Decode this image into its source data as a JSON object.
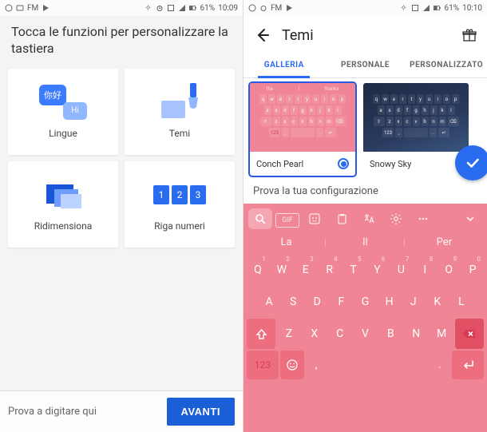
{
  "status1": {
    "fm": "FM",
    "pct": "61%",
    "time": "10:09"
  },
  "status2": {
    "fm": "FM",
    "pct": "61%",
    "time": "10:10"
  },
  "left": {
    "header": "Tocca le funzioni per personalizzare la tastiera",
    "tiles": {
      "lingue": {
        "label": "Lingue",
        "b1": "你好",
        "b2": "Hi"
      },
      "temi": {
        "label": "Temi"
      },
      "ridim": {
        "label": "Ridimensiona"
      },
      "riga": {
        "label": "Riga numeri",
        "n1": "1",
        "n2": "2",
        "n3": "3"
      }
    },
    "hint": "Prova a digitare qui",
    "avanti": "AVANTI"
  },
  "right": {
    "title": "Temi",
    "tabs": {
      "t1": "GALLERIA",
      "t2": "PERSONALE",
      "t3": "PERSONALIZZATO"
    },
    "themes": {
      "conch": {
        "name": "Conch Pearl",
        "sug": {
          "a": "the",
          "b": "I",
          "c": "thanks"
        }
      },
      "snowy": {
        "name": "Snowy Sky"
      }
    },
    "prova": "Prova la tua configurazione",
    "live": {
      "gif": "GIF",
      "sug": {
        "a": "La",
        "b": "Il",
        "c": "Per"
      },
      "row1": [
        "Q",
        "W",
        "E",
        "R",
        "T",
        "Y",
        "U",
        "I",
        "O",
        "P"
      ],
      "row2": [
        "A",
        "S",
        "D",
        "F",
        "G",
        "H",
        "J",
        "K",
        "L"
      ],
      "row3": [
        "Z",
        "X",
        "C",
        "V",
        "B",
        "N",
        "M"
      ],
      "num": "123",
      "comma": ",",
      "dot": "."
    }
  }
}
